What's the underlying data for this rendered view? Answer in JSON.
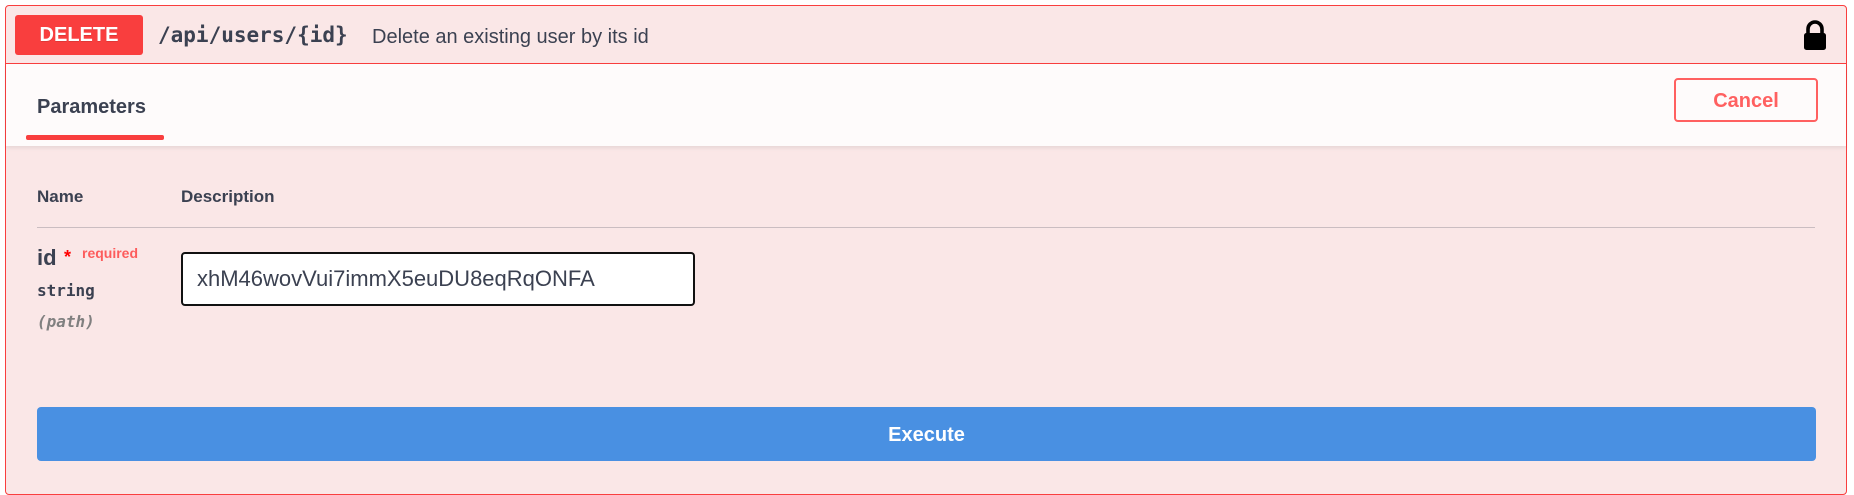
{
  "operation": {
    "method": "DELETE",
    "path": "/api/users/{id}",
    "summary": "Delete an existing user by its id",
    "lock_icon": "lock-icon"
  },
  "section": {
    "tab_label": "Parameters",
    "cancel_label": "Cancel"
  },
  "table": {
    "headers": [
      "Name",
      "Description"
    ]
  },
  "parameter": {
    "name": "id",
    "required_marker": "*",
    "required_label": "required",
    "type": "string",
    "location": "(path)",
    "value": "xhM46wovVui7immX5euDU8eqRqONFA"
  },
  "execute_label": "Execute",
  "colors": {
    "delete": "#f93e3e",
    "block_background": "#fae7e7",
    "cancel": "#ff6060",
    "execute": "#4990e2",
    "text": "#3b4151"
  }
}
